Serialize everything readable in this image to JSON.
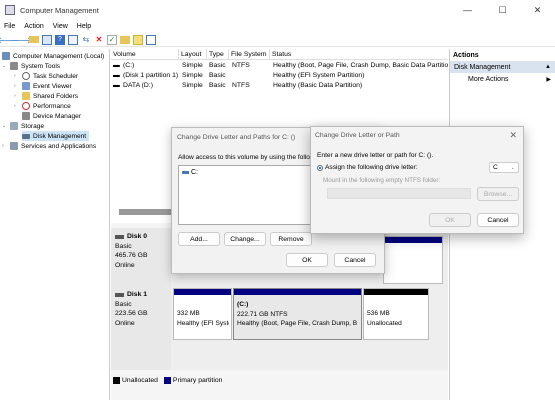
{
  "window": {
    "title": "Computer Management",
    "minimize": "—",
    "maximize": "☐",
    "close": "✕"
  },
  "menu": [
    "File",
    "Action",
    "View",
    "Help"
  ],
  "tree": {
    "root": "Computer Management (Local)",
    "system_tools": "System Tools",
    "task_scheduler": "Task Scheduler",
    "event_viewer": "Event Viewer",
    "shared_folders": "Shared Folders",
    "performance": "Performance",
    "device_manager": "Device Manager",
    "storage": "Storage",
    "disk_management": "Disk Management",
    "services": "Services and Applications"
  },
  "volumes": {
    "headers": [
      "Volume",
      "Layout",
      "Type",
      "File System",
      "Status"
    ],
    "rows": [
      {
        "volume": "(C:)",
        "layout": "Simple",
        "type": "Basic",
        "fs": "NTFS",
        "status": "Healthy (Boot, Page File, Crash Dump, Basic Data Partition)"
      },
      {
        "volume": "(Disk 1 partition 1)",
        "layout": "Simple",
        "type": "Basic",
        "fs": "",
        "status": "Healthy (EFI System Partition)"
      },
      {
        "volume": "DATA (D:)",
        "layout": "Simple",
        "type": "Basic",
        "fs": "NTFS",
        "status": "Healthy (Basic Data Partition)"
      }
    ]
  },
  "disk0": {
    "name": "Disk 0",
    "type": "Basic",
    "size": "465.76 GB",
    "state": "Online"
  },
  "disk1": {
    "name": "Disk 1",
    "type": "Basic",
    "size": "223.56 GB",
    "state": "Online",
    "parts": [
      {
        "name": "",
        "size": "332 MB",
        "status": "Healthy (EFI Syste"
      },
      {
        "name": "(C:)",
        "size": "222.71 GB NTFS",
        "status": "Healthy (Boot, Page File, Crash Dump, B"
      },
      {
        "name": "",
        "size": "536 MB",
        "status": "Unallocated"
      }
    ]
  },
  "legend": {
    "unallocated": "Unallocated",
    "primary": "Primary partition"
  },
  "actions": {
    "header": "Actions",
    "section": "Disk Management",
    "more": "More Actions"
  },
  "dialog_paths": {
    "title": "Change Drive Letter and Paths for C: ()",
    "instruction": "Allow access to this volume by using the following",
    "list_item": "C:",
    "add": "Add...",
    "change": "Change...",
    "remove": "Remove",
    "ok": "OK",
    "cancel": "Cancel"
  },
  "dialog_letter": {
    "title": "Change Drive Letter or Path",
    "prompt": "Enter a new drive letter or path for C: ().",
    "assign": "Assign the following drive letter:",
    "letter": "C",
    "mount": "Mount in the following empty NTFS folder:",
    "browse": "Browse...",
    "ok": "OK",
    "cancel": "Cancel"
  },
  "colors": {
    "primary_partition": "#000080",
    "unallocated": "#000000",
    "selection": "#cde4f7"
  }
}
